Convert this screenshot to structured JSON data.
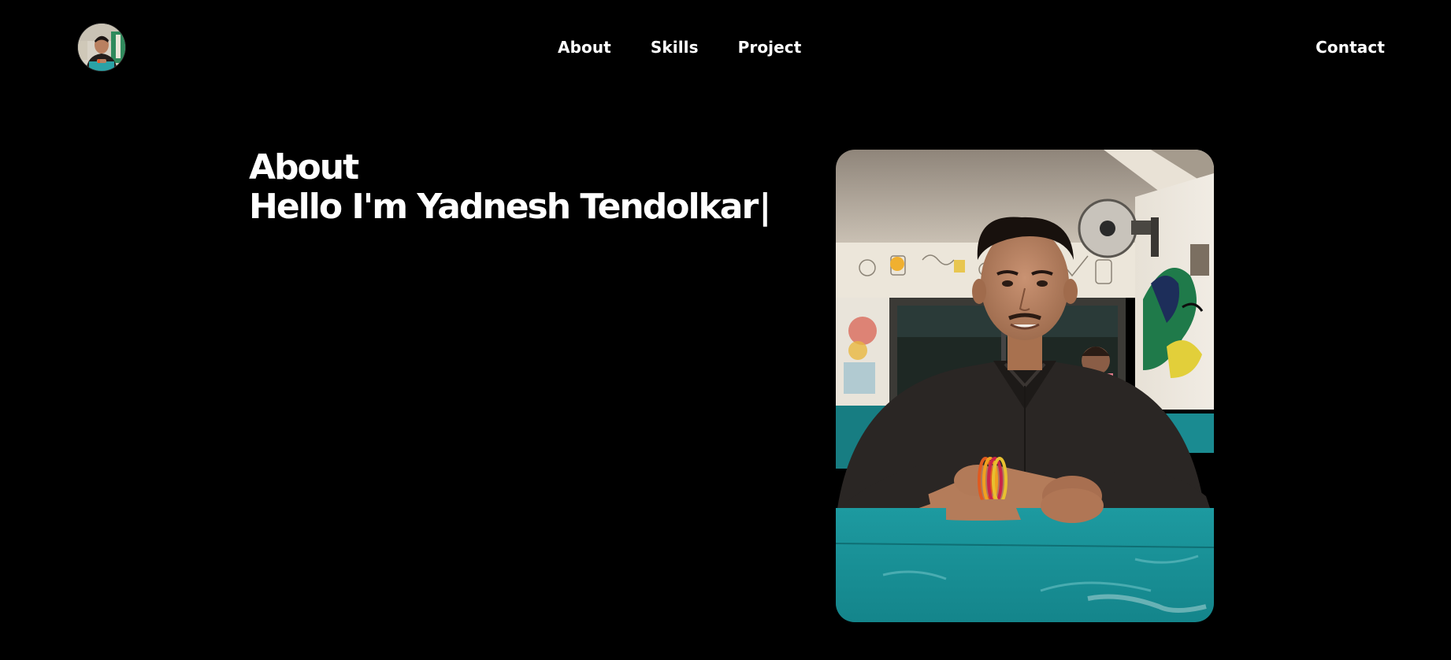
{
  "header": {
    "avatar_alt": "Profile photo",
    "nav": [
      {
        "label": "About"
      },
      {
        "label": "Skills"
      },
      {
        "label": "Project"
      }
    ],
    "contact_label": "Contact"
  },
  "hero": {
    "title": "About",
    "greeting": "Hello I'm Yadnesh Tendolkar",
    "cursor": "|"
  },
  "colors": {
    "background": "#000000",
    "text": "#ffffff",
    "table_teal": "#1a9aa0",
    "shirt": "#2a2624",
    "wall": "#d9d3c8"
  }
}
